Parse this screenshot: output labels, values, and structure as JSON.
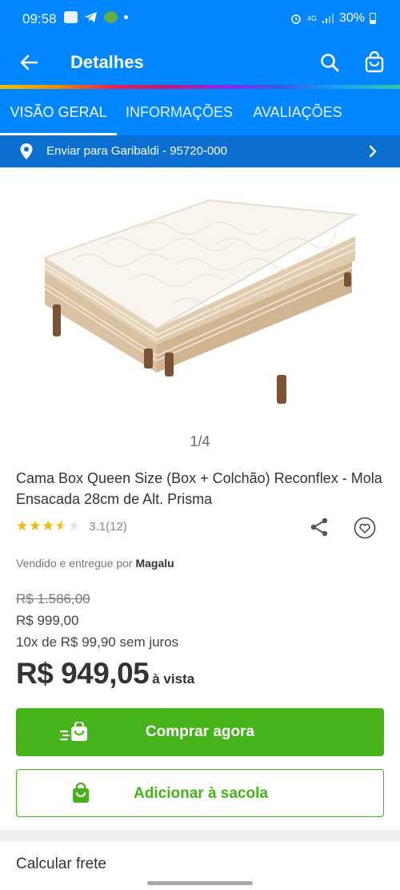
{
  "status_bar": {
    "time": "09:58",
    "signal": "4G",
    "battery": "30%"
  },
  "app_bar": {
    "title": "Detalhes"
  },
  "tabs": [
    {
      "label": "VISÃO GERAL",
      "active": true
    },
    {
      "label": "INFORMAÇÕES",
      "active": false
    },
    {
      "label": "AVALIAÇÕES",
      "active": false
    }
  ],
  "shipping": {
    "text": "Enviar para Garibaldi - 95720-000"
  },
  "product": {
    "image_counter": "1/4",
    "title": "Cama Box Queen Size (Box + Colchão) Reconflex - Mola Ensacada 28cm de Alt. Prisma",
    "rating_value": 3.1,
    "rating_text": "3.1(12)",
    "seller_prefix": "Vendido e entregue por",
    "seller_name": "Magalu",
    "old_price": "R$ 1.586,00",
    "list_price": "R$ 999,00",
    "installments": "10x de R$ 99,90 sem juros",
    "cash_price": "R$ 949,05",
    "cash_suffix": "à vista"
  },
  "actions": {
    "buy_now": "Comprar agora",
    "add_to_bag": "Adicionar à sacola"
  },
  "sections": {
    "shipping_calc": "Calcular frete"
  },
  "colors": {
    "primary": "#0086ff",
    "accent_green": "#46b31b"
  }
}
